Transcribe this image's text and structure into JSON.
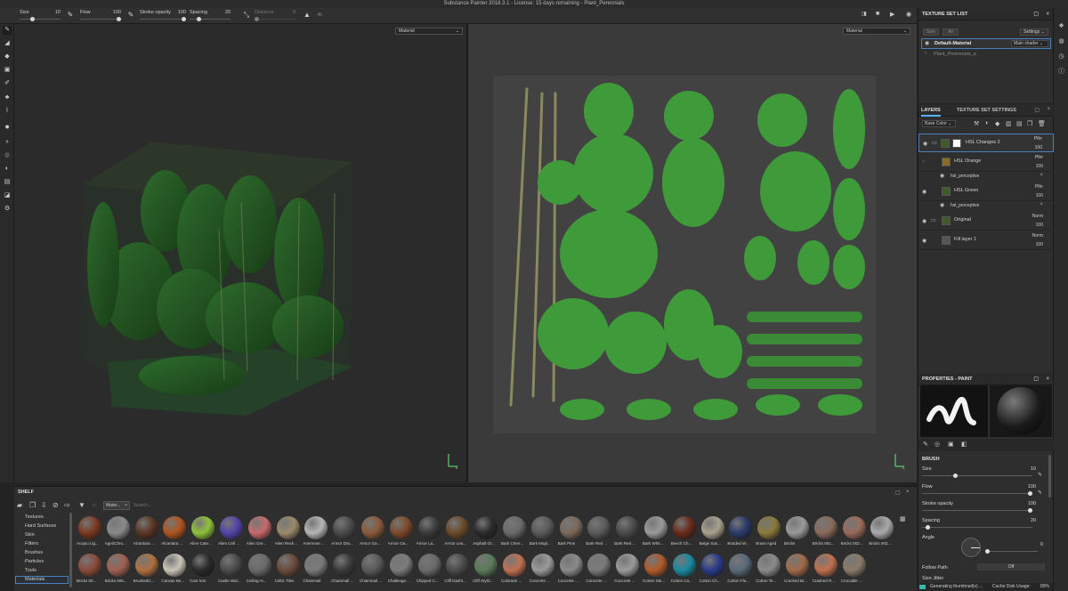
{
  "window": {
    "title": "Substance Painter 2018.3.1 - License: 15 days remaining - Plant_Perennials"
  },
  "toolbar": {
    "size_label": "Size",
    "size_value": "10",
    "flow_label": "Flow",
    "flow_value": "100",
    "stroke_opacity_label": "Stroke opacity",
    "stroke_opacity_value": "100",
    "spacing_label": "Spacing",
    "spacing_value": "20",
    "distance_label": "Distance",
    "distance_value": "0",
    "extra_label": "4b"
  },
  "viewport3d": {
    "mode": "Material",
    "axis_label": "z"
  },
  "viewport2d": {
    "mode": "Material",
    "axis_label": "z"
  },
  "texture_set_list": {
    "title": "TEXTURE SET LIST",
    "btn_solo": "Solo",
    "btn_all": "All",
    "settings_label": "Settings",
    "items": [
      {
        "name": "Default-Material",
        "shader": "Main shader"
      },
      {
        "name": "Plant_Perennials_a",
        "shader": ""
      }
    ]
  },
  "layers": {
    "tab_layers": "LAYERS",
    "tab_tss": "TEXTURE SET SETTINGS",
    "channel": "Base Color",
    "rows": [
      {
        "name": "HSL Changes 2",
        "blend": "Pthr",
        "opacity": "100"
      },
      {
        "name": "HSL Orange",
        "blend": "Pthr",
        "opacity": "100"
      },
      {
        "name": "HSL Green",
        "blend": "Pthr",
        "opacity": "100"
      },
      {
        "name": "Original",
        "blend": "Norm",
        "opacity": "100"
      },
      {
        "name": "Fill layer 1",
        "blend": "Norm",
        "opacity": "100"
      }
    ],
    "effects": [
      {
        "name": "hsl_perceptive"
      },
      {
        "name": "hsl_perceptive"
      }
    ]
  },
  "properties": {
    "title": "PROPERTIES - PAINT",
    "section": "BRUSH",
    "size_label": "Size",
    "size_value": "10",
    "flow_label": "Flow",
    "flow_value": "100",
    "stroke_opacity_label": "Stroke opacity",
    "stroke_opacity_value": "100",
    "spacing_label": "Spacing",
    "spacing_value": "20",
    "angle_label": "Angle",
    "angle_value": "0",
    "follow_path_label": "Follow Path",
    "follow_path_value": "Off",
    "size_jitter_label": "Size Jitter"
  },
  "shelf": {
    "title": "SHELF",
    "filter_tag": "Mater...",
    "search_placeholder": "Search...",
    "categories": [
      "Textures",
      "Hard Surfaces",
      "Skin",
      "Filters",
      "Brushes",
      "Particles",
      "Tools",
      "Materials"
    ],
    "selected_category": "Materials",
    "materials_row1": [
      {
        "name": "Acajou Lig...",
        "color": "#7a3a20"
      },
      {
        "name": "AgedChro...",
        "color": "#8a8a8a"
      },
      {
        "name": "Alcantara ...",
        "color": "#5a3524"
      },
      {
        "name": "Alcantara ...",
        "color": "#b0541e"
      },
      {
        "name": "Alien Cate...",
        "color": "#8fc23a"
      },
      {
        "name": "Alien Cell ...",
        "color": "#5244a8"
      },
      {
        "name": "Alien Gre...",
        "color": "#c86a6a"
      },
      {
        "name": "Alien Reck...",
        "color": "#9a8a6a"
      },
      {
        "name": "Anemone ...",
        "color": "#b5b5b5"
      },
      {
        "name": "Armor Dra...",
        "color": "#4a4a4a"
      },
      {
        "name": "Armor Ga...",
        "color": "#8a5a3a"
      },
      {
        "name": "Armor Ga...",
        "color": "#7a4a2a"
      },
      {
        "name": "Armor La...",
        "color": "#3a3a3a"
      },
      {
        "name": "Armor Lea...",
        "color": "#6a4a2a"
      },
      {
        "name": "Asphalt Gr...",
        "color": "#2a2a2a"
      },
      {
        "name": "Bark Cherr...",
        "color": "#6a6a6a"
      },
      {
        "name": "Bark Mapl...",
        "color": "#5a5a5a"
      },
      {
        "name": "Bark Pine",
        "color": "#7a6a5a"
      },
      {
        "name": "Bark Red ...",
        "color": "#5a5a5a"
      },
      {
        "name": "Bark Red ...",
        "color": "#4a4a4a"
      },
      {
        "name": "Bark Whit...",
        "color": "#9a9a9a"
      },
      {
        "name": "Beech Ch...",
        "color": "#6a2a1a"
      },
      {
        "name": "Beige San...",
        "color": "#a9a08e"
      },
      {
        "name": "Braided W...",
        "color": "#2a3a6a"
      },
      {
        "name": "Brass Aged",
        "color": "#8a7a3a"
      },
      {
        "name": "Bricks",
        "color": "#9a9a9a"
      },
      {
        "name": "Bricks 001...",
        "color": "#8a6a5a"
      },
      {
        "name": "Bricks 002...",
        "color": "#9a6a5a"
      },
      {
        "name": "Bricks 003...",
        "color": "#aaaaaa"
      }
    ],
    "materials_row2": [
      {
        "name": "Bricks 00...",
        "color": "#8a4a3a"
      },
      {
        "name": "Bricks 005...",
        "color": "#a06050"
      },
      {
        "name": "BrushedC...",
        "color": "#b07040"
      },
      {
        "name": "Canvas Be...",
        "color": "#c9c5b6"
      },
      {
        "name": "Cast Iron",
        "color": "#2a2a2a"
      },
      {
        "name": "Castle Wal...",
        "color": "#4a4a4a"
      },
      {
        "name": "Ceiling Ar...",
        "color": "#6a6a6a"
      },
      {
        "name": "Celtic Tiles",
        "color": "#6a4a3a"
      },
      {
        "name": "Chainmail",
        "color": "#7a7a7a"
      },
      {
        "name": "Chainmail ...",
        "color": "#3a3a3a"
      },
      {
        "name": "Chainmail ...",
        "color": "#5a5a5a"
      },
      {
        "name": "Challenge...",
        "color": "#7a7a7a"
      },
      {
        "name": "Chipped C...",
        "color": "#6a6a6a"
      },
      {
        "name": "Cliff Dasht...",
        "color": "#4a4a4a"
      },
      {
        "name": "Cliff Styliz...",
        "color": "#5a7a5a"
      },
      {
        "name": "Colorado ...",
        "color": "#c07050"
      },
      {
        "name": "Concrete ...",
        "color": "#9a9a9a"
      },
      {
        "name": "Concrete ...",
        "color": "#8a8a8a"
      },
      {
        "name": "Concrete ...",
        "color": "#7a7a7a"
      },
      {
        "name": "Concrete ...",
        "color": "#9a9a9a"
      },
      {
        "name": "Corten Ste...",
        "color": "#b05a2a"
      },
      {
        "name": "Cotton Ca...",
        "color": "#1a8aa0"
      },
      {
        "name": "Cotton Ch...",
        "color": "#2a3a8a"
      },
      {
        "name": "Cotton Fla...",
        "color": "#5a6a7a"
      },
      {
        "name": "Cotton Te...",
        "color": "#8a8a8a"
      },
      {
        "name": "Cracked Br...",
        "color": "#a06a4a"
      },
      {
        "name": "Crashed R...",
        "color": "#c07050"
      },
      {
        "name": "Crocodile ...",
        "color": "#8a7a6a"
      }
    ]
  },
  "status": {
    "generating": "Generating thumbnail(s) ...",
    "cache_label": "Cache Disk Usage:",
    "cache_value": "89%"
  }
}
